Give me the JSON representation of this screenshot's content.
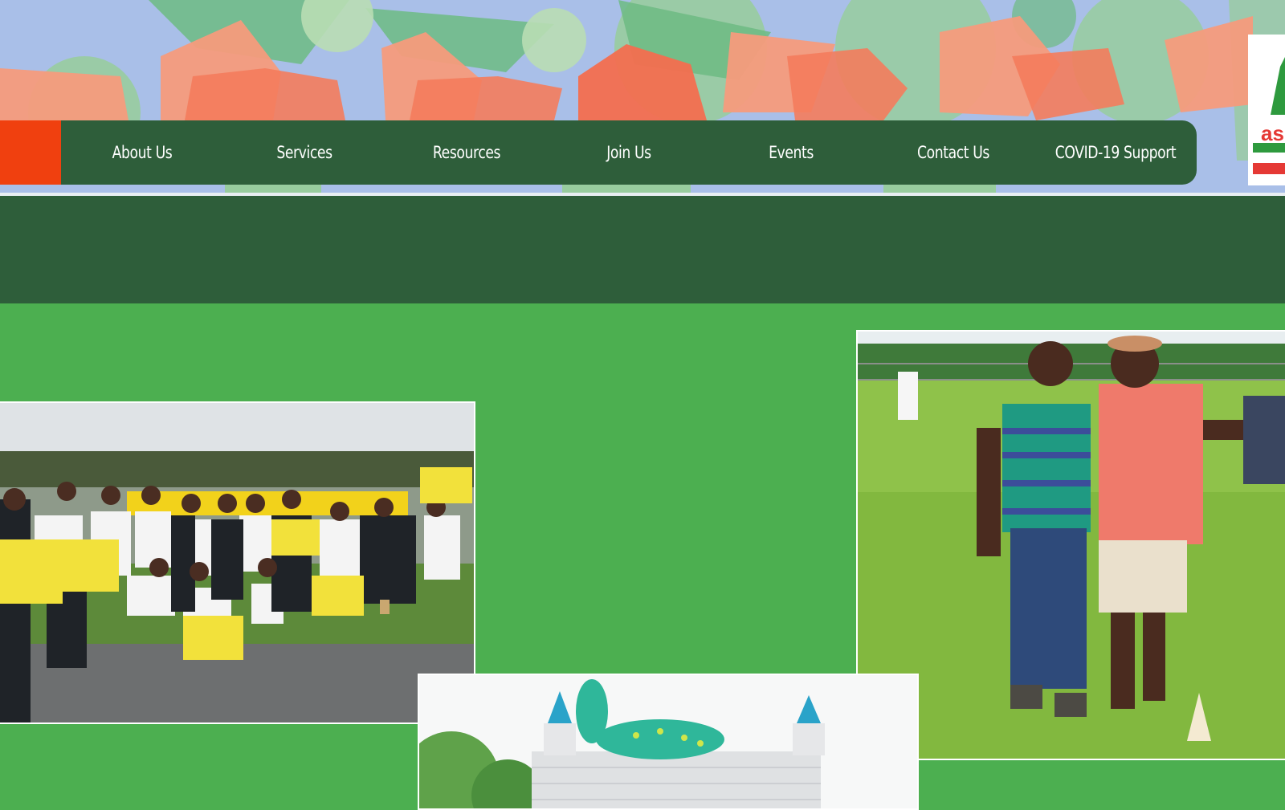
{
  "nav": {
    "items": [
      {
        "label": "About Us"
      },
      {
        "label": "Services"
      },
      {
        "label": "Resources"
      },
      {
        "label": "Join Us"
      },
      {
        "label": "Events"
      },
      {
        "label": "Contact Us"
      },
      {
        "label": "COVID-19 Support"
      }
    ]
  },
  "logo": {
    "text": "as"
  },
  "photos": {
    "group": "group-photo",
    "friends": "friends-photo",
    "castle": "bouncy-castle-photo"
  },
  "colors": {
    "nav_bg": "#2e5e3a",
    "accent": "#f0400f",
    "page_bg": "#4caf50",
    "band_bg": "#2e5e3a"
  }
}
